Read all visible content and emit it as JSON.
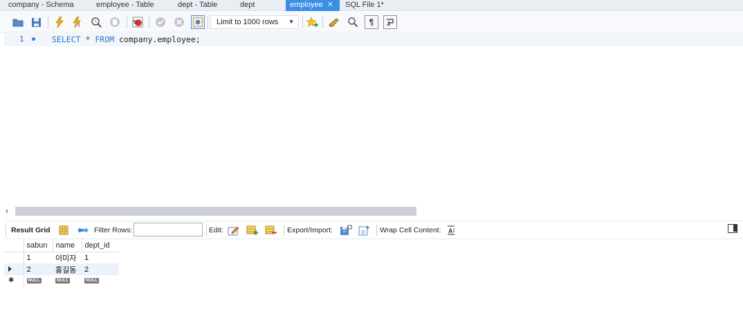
{
  "tabs": [
    {
      "label": "company - Schema",
      "active": false
    },
    {
      "label": "employee - Table",
      "active": false
    },
    {
      "label": "dept - Table",
      "active": false
    },
    {
      "label": "dept",
      "active": false
    },
    {
      "label": "employee",
      "active": true
    },
    {
      "label": "SQL File 1*",
      "active": false
    }
  ],
  "toolbar": {
    "limit_label": "Limit to 1000 rows"
  },
  "editor": {
    "line_number": "1",
    "tokens": {
      "select": "SELECT",
      "star": "*",
      "from": "FROM",
      "table": "company.employee;"
    }
  },
  "result_toolbar": {
    "result_grid": "Result Grid",
    "filter_rows": "Filter Rows:",
    "filter_value": "",
    "edit": "Edit:",
    "export_import": "Export/Import:",
    "wrap_cell": "Wrap Cell Content:"
  },
  "grid": {
    "columns": [
      "sabun",
      "name",
      "dept_id"
    ],
    "rows": [
      [
        "1",
        "이미자",
        "1"
      ],
      [
        "2",
        "홍길동",
        "2"
      ]
    ],
    "null_label": "NULL"
  },
  "colors": {
    "active_tab": "#3a8ee6",
    "keyword": "#2a7bd4"
  }
}
